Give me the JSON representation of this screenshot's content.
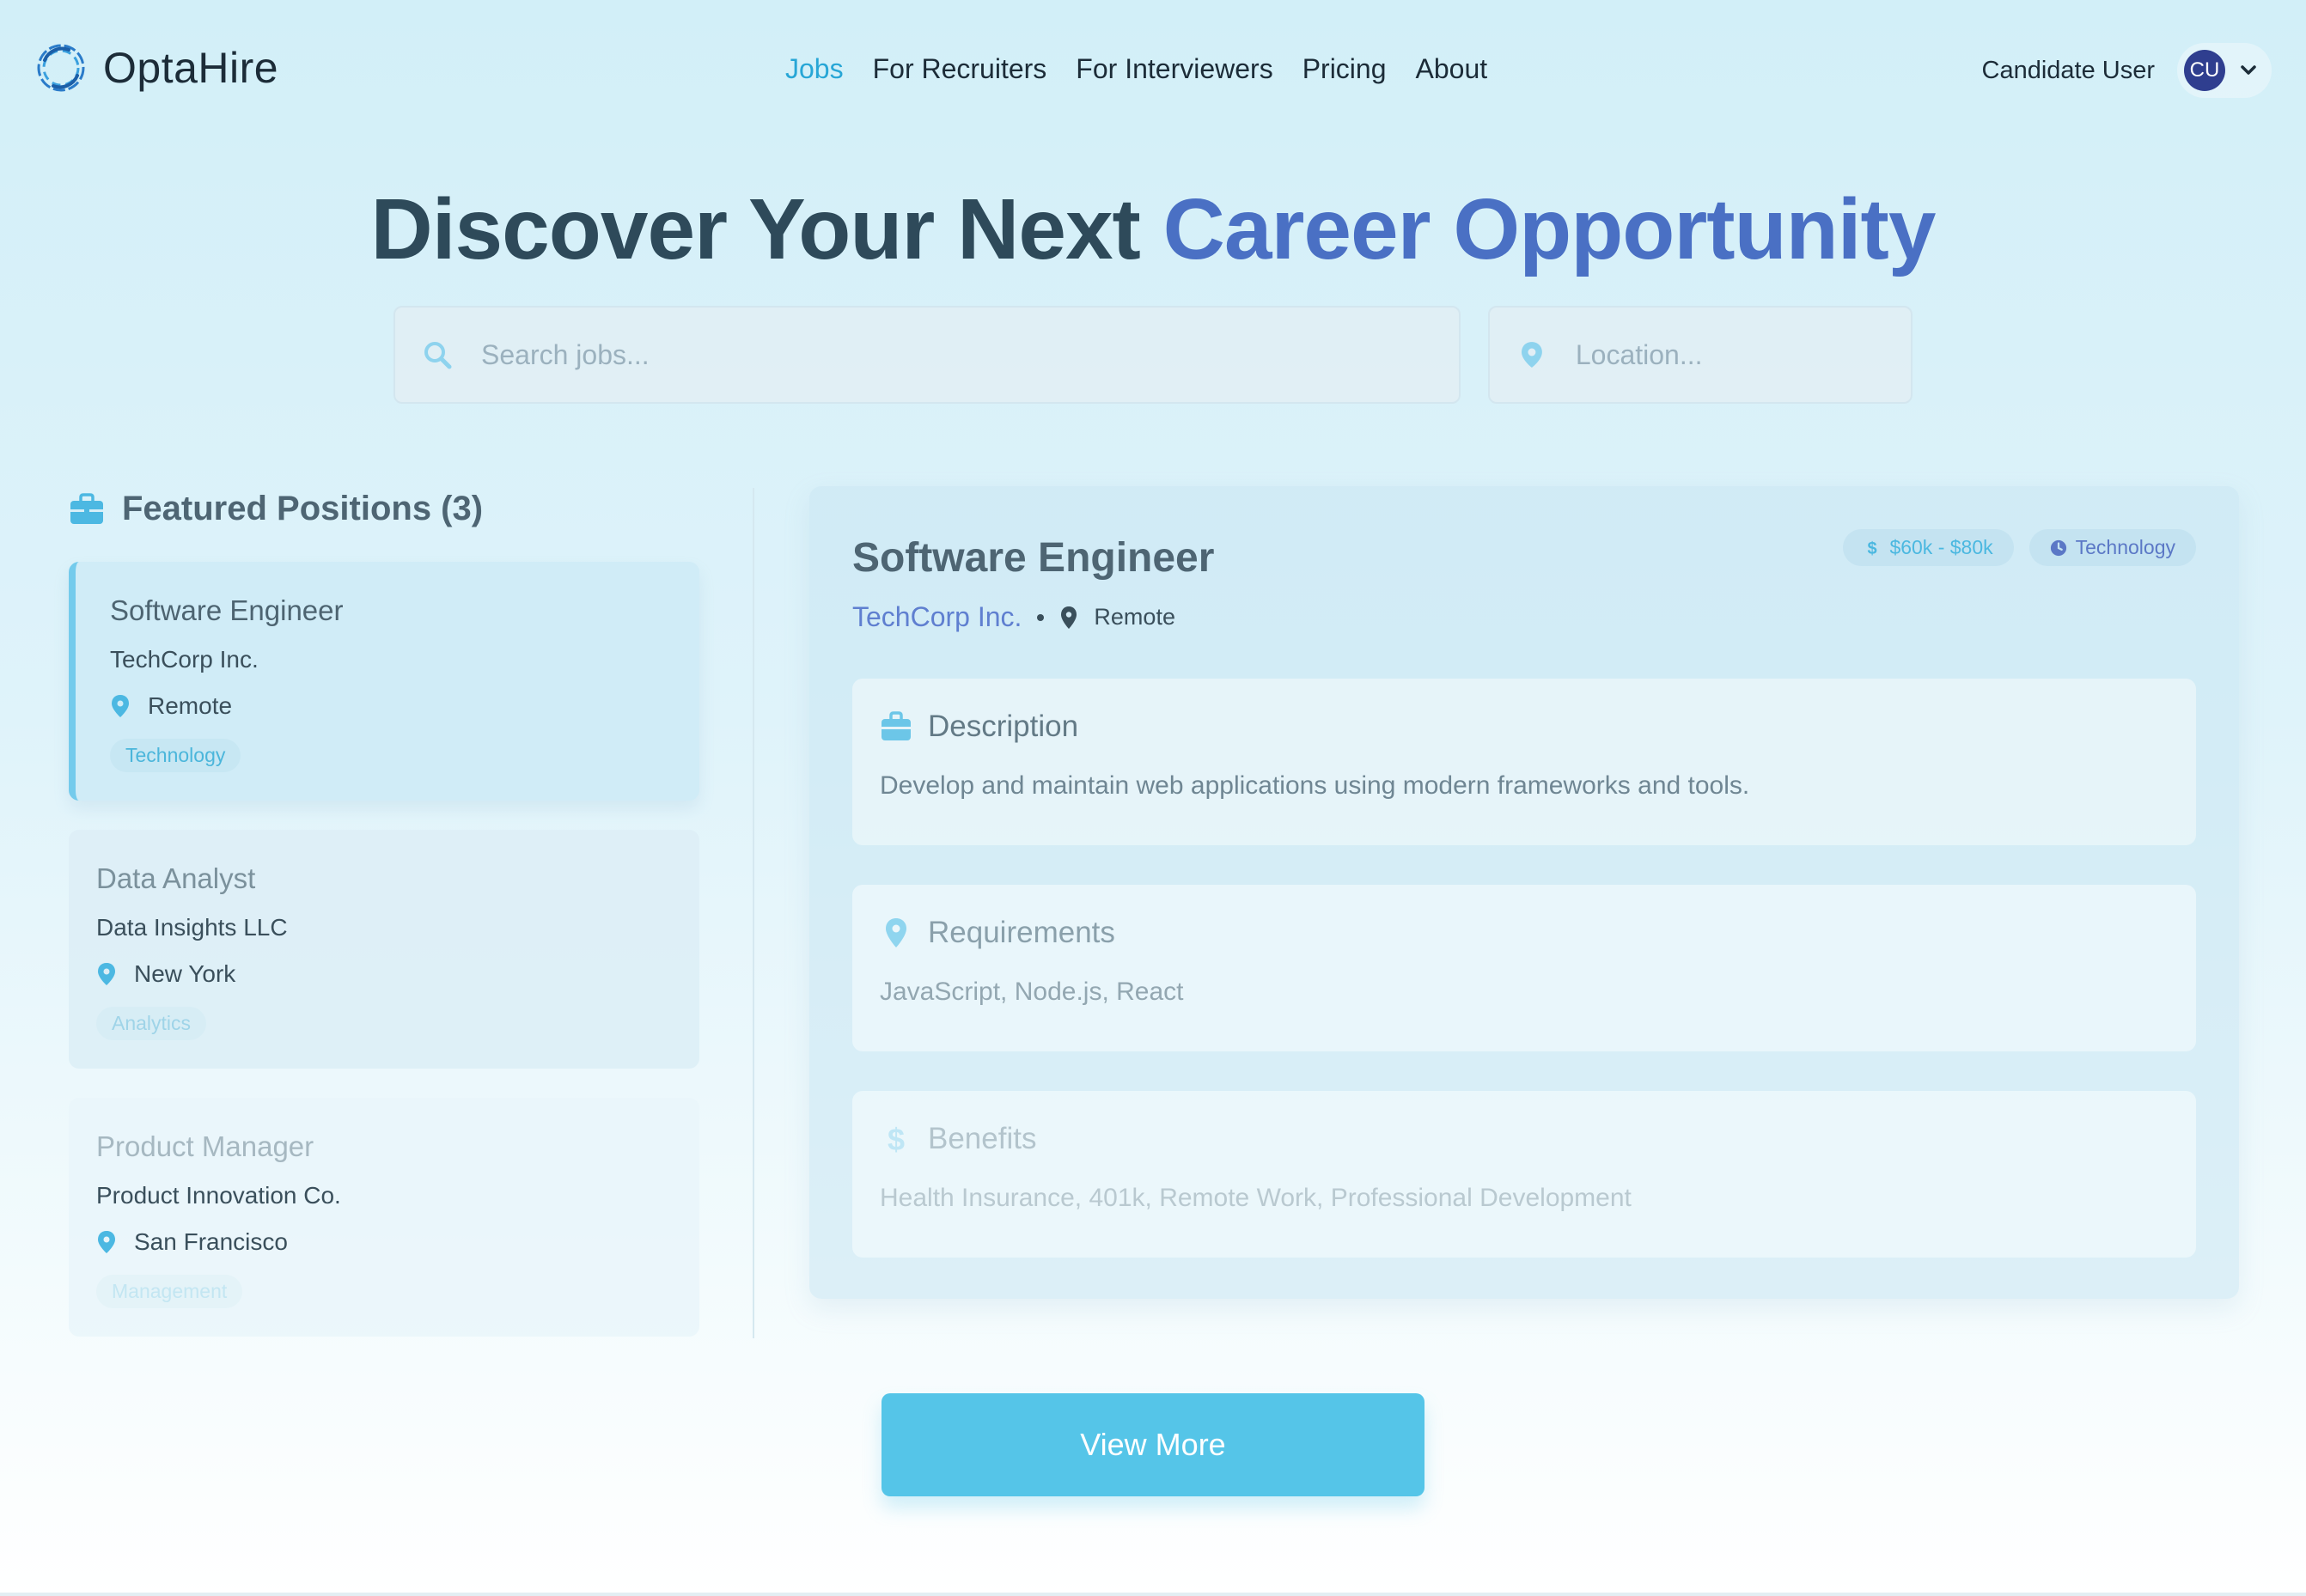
{
  "nav": {
    "brand": "OptaHire",
    "links": [
      "Jobs",
      "For Recruiters",
      "For Interviewers",
      "Pricing",
      "About"
    ],
    "active_link": "Jobs",
    "user_name": "Candidate User",
    "avatar_initials": "CU"
  },
  "hero": {
    "title_part1": "Discover Your Next",
    "title_part2": "Career Opportunity",
    "search_placeholder": "Search jobs...",
    "location_placeholder": "Location..."
  },
  "featured": {
    "heading": "Featured Positions (3)",
    "jobs": [
      {
        "title": "Software Engineer",
        "company": "TechCorp Inc.",
        "location": "Remote",
        "tag": "Technology",
        "selected": true
      },
      {
        "title": "Data Analyst",
        "company": "Data Insights LLC",
        "location": "New York",
        "tag": "Analytics",
        "selected": false
      },
      {
        "title": "Product Manager",
        "company": "Product Innovation Co.",
        "location": "San Francisco",
        "tag": "Management",
        "selected": false
      }
    ]
  },
  "detail": {
    "title": "Software Engineer",
    "company": "TechCorp Inc.",
    "location": "Remote",
    "salary": "$60k - $80k",
    "category": "Technology",
    "sections": {
      "description": {
        "heading": "Description",
        "body": "Develop and maintain web applications using modern frameworks and tools."
      },
      "requirements": {
        "heading": "Requirements",
        "body": "JavaScript, Node.js, React"
      },
      "benefits": {
        "heading": "Benefits",
        "body": "Health Insurance, 401k, Remote Work, Professional Development"
      }
    }
  },
  "view_more_label": "View More",
  "colors": {
    "accent": "#27a6d6",
    "button": "#55c5e8",
    "title_accent": "#4a70c4",
    "avatar": "#2f3e8f"
  },
  "icons": {
    "logo": "optahire-logo-icon",
    "search": "search-icon",
    "location": "map-pin-icon",
    "briefcase": "briefcase-icon",
    "dollar": "dollar-icon",
    "clock": "clock-icon",
    "chevron": "chevron-down-icon"
  }
}
